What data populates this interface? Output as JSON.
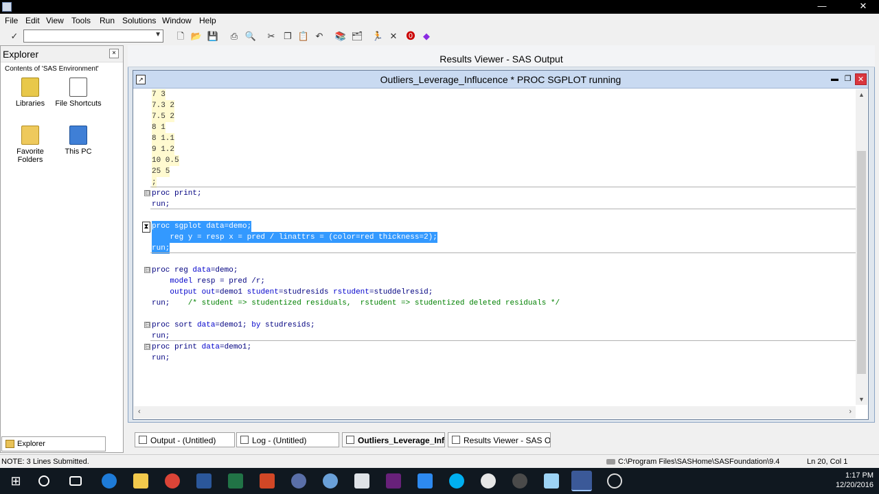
{
  "menubar": {
    "items": [
      "File",
      "Edit",
      "View",
      "Tools",
      "Run",
      "Solutions",
      "Window",
      "Help"
    ]
  },
  "toolbar": {
    "command_value": "",
    "icons": [
      "check-icon",
      "new-icon",
      "open-icon",
      "save-icon",
      "print-icon",
      "print-preview-icon",
      "cut-icon",
      "copy-icon",
      "paste-icon",
      "undo-icon",
      "library-icon",
      "explorer-icon",
      "submit-icon",
      "clear-icon",
      "help-icon",
      "book-icon"
    ]
  },
  "explorer": {
    "title": "Explorer",
    "close": "×",
    "subtitle": "Contents of 'SAS Environment'",
    "items": [
      {
        "label": "Libraries",
        "icon": "libraries-icon"
      },
      {
        "label": "File Shortcuts",
        "icon": "file-shortcuts-icon"
      },
      {
        "label": "Favorite Folders",
        "icon": "favorite-folders-icon"
      },
      {
        "label": "This PC",
        "icon": "this-pc-icon"
      }
    ],
    "tab_label": "Explorer"
  },
  "results_viewer": {
    "title": "Results Viewer - SAS Output"
  },
  "editor": {
    "title": "Outliers_Leverage_Influcence *   PROC SGPLOT running",
    "buttons": {
      "minimize": "▬",
      "maximize": "❐",
      "close": "✕"
    },
    "data_lines": [
      "7 3",
      "7.3 2",
      "7.5 2",
      "8 1",
      "8 1.1",
      "9 1.2",
      "10 0.5",
      "25 5",
      ";"
    ],
    "block_print1": [
      "proc print;",
      "run;"
    ],
    "block_sgplot": [
      "proc sgplot data=demo;",
      "    reg y = resp x = pred / linattrs = (color=red thickness=2);",
      "run;"
    ],
    "block_reg": {
      "l1_kw": "proc reg ",
      "l1_opt": "data",
      "l1_rest": "=demo;",
      "l2_kw": "    model ",
      "l2_rest": "resp = pred /r;",
      "l3_kw": "    output out",
      "l3_a": "=demo1 ",
      "l3_b": "student",
      "l3_c": "=studresids ",
      "l3_d": "rstudent",
      "l3_e": "=studdelresid;",
      "l4_kw": "run;",
      "l4_cm": "    /* student => studentized residuals,  rstudent => studentized deleted residuals */"
    },
    "block_sort": {
      "kw": "proc sort ",
      "opt": "data",
      "rest": "=demo1; ",
      "by": "by ",
      "byvar": "studresids;",
      "run": "run;"
    },
    "block_print2": {
      "kw": "proc print ",
      "opt": "data",
      "rest": "=demo1;",
      "run": "run;"
    },
    "fold_symbol": "⊟"
  },
  "window_tabs": [
    {
      "label": "Output - (Untitled)"
    },
    {
      "label": "Log - (Untitled)"
    },
    {
      "label": "Outliers_Leverage_Infl..."
    },
    {
      "label": "Results Viewer - SAS Ou..."
    }
  ],
  "statusbar": {
    "note": "NOTE: 3 Lines Submitted.",
    "path": "C:\\Program Files\\SASHome\\SASFoundation\\9.4",
    "position": "Ln 20, Col 1"
  },
  "taskbar": {
    "icons": [
      "windows-start-icon",
      "cortana-icon",
      "task-view-icon",
      "edge-icon",
      "file-explorer-icon",
      "chrome-icon",
      "word-icon",
      "excel-icon",
      "powerpoint-icon",
      "sas-icon",
      "browser-icon",
      "calculator-icon",
      "visual-studio-icon",
      "app-icon",
      "skype-icon",
      "xbox-icon",
      "camera-icon",
      "notepad-icon",
      "sas-active-icon",
      "settings-icon"
    ],
    "time": "1:17 PM",
    "date": "12/20/2016"
  },
  "colors": {
    "selection": "#3399ff",
    "keyword": "#000080",
    "comment": "#008000",
    "data_bg": "#fffad0",
    "caption": "#c9daf1"
  }
}
